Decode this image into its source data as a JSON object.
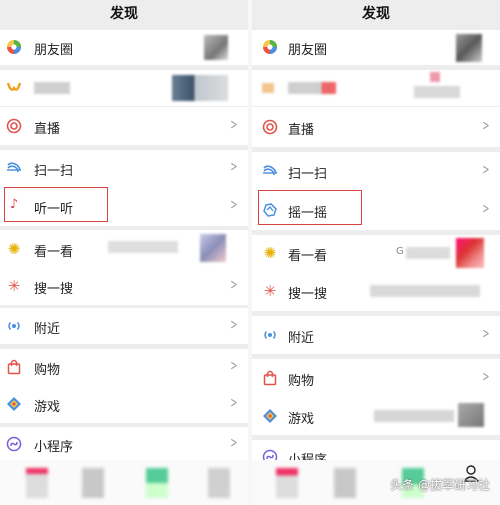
{
  "page_title": "发现",
  "watermark": "头条 @拔萃研习社",
  "colors": {
    "highlight": "#d9433f",
    "background": "#ededed",
    "chevron": "#9a9a9a"
  },
  "left": {
    "title": "发现",
    "items": {
      "moments": {
        "label": "朋友圈",
        "icon": "moments-icon"
      },
      "channels": {
        "label": "",
        "icon": "channels-icon"
      },
      "live": {
        "label": "直播",
        "icon": "live-icon"
      },
      "scan": {
        "label": "扫一扫",
        "icon": "scan-icon"
      },
      "listen": {
        "label": "听一听",
        "icon": "music-note-icon"
      },
      "top_stories": {
        "label": "看一看",
        "icon": "top-stories-icon"
      },
      "search": {
        "label": "搜一搜",
        "icon": "search-icon"
      },
      "nearby": {
        "label": "附近",
        "icon": "nearby-icon"
      },
      "shopping": {
        "label": "购物",
        "icon": "shopping-bag-icon"
      },
      "games": {
        "label": "游戏",
        "icon": "games-icon"
      },
      "mini_programs": {
        "label": "小程序",
        "icon": "mini-programs-icon"
      }
    }
  },
  "right": {
    "title": "发现",
    "items": {
      "moments": {
        "label": "朋友圈",
        "icon": "moments-icon"
      },
      "channels": {
        "label": "",
        "icon": "channels-icon"
      },
      "live": {
        "label": "直播",
        "icon": "live-icon"
      },
      "scan": {
        "label": "扫一扫",
        "icon": "scan-icon"
      },
      "shake": {
        "label": "摇一摇",
        "icon": "shake-icon"
      },
      "top_stories": {
        "label": "看一看",
        "icon": "top-stories-icon"
      },
      "search": {
        "label": "搜一搜",
        "icon": "search-icon"
      },
      "nearby": {
        "label": "附近",
        "icon": "nearby-icon"
      },
      "shopping": {
        "label": "购物",
        "icon": "shopping-bag-icon"
      },
      "games": {
        "label": "游戏",
        "icon": "games-icon"
      },
      "mini_programs": {
        "label": "小程序",
        "icon": "mini-programs-icon"
      }
    },
    "search_hint": "",
    "top_stories_hint": "G"
  },
  "tabbar": {
    "tabs": [
      "chats-tab-icon",
      "contacts-tab-icon",
      "discover-tab-icon",
      "me-tab-icon"
    ]
  }
}
